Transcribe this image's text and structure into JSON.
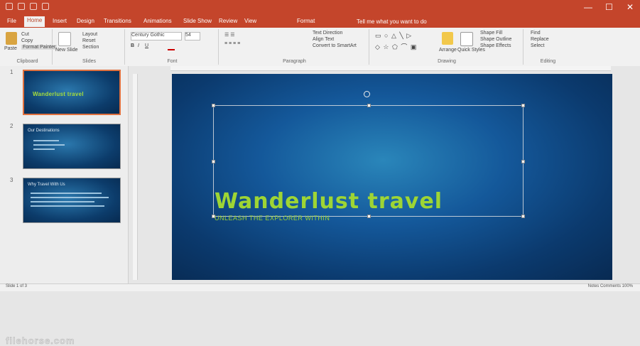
{
  "app": {
    "window_title": "",
    "title_color": "#c4452b",
    "accent_color": "#b7472a"
  },
  "quick_access": {
    "icons": [
      "save-icon",
      "undo-icon",
      "redo-icon",
      "start-slideshow-icon"
    ]
  },
  "window_controls": {
    "minimize": "—",
    "restore": "☐",
    "close": "✕"
  },
  "tabs": [
    {
      "label": "File"
    },
    {
      "label": "Home",
      "active": true
    },
    {
      "label": "Insert"
    },
    {
      "label": "Design"
    },
    {
      "label": "Transitions"
    },
    {
      "label": "Animations"
    },
    {
      "label": "Slide Show"
    },
    {
      "label": "Review"
    },
    {
      "label": "View"
    },
    {
      "label": "Format"
    }
  ],
  "tell_me": "Tell me what you want to do",
  "ribbon": {
    "clipboard": {
      "paste": "Paste",
      "cut": "Cut",
      "copy": "Copy",
      "format_painter": "Format Painter",
      "title": "Clipboard"
    },
    "slides": {
      "new_slide": "New Slide",
      "layout": "Layout",
      "reset": "Reset",
      "section": "Section",
      "title": "Slides"
    },
    "font": {
      "font_name": "Century Gothic",
      "font_size": "54",
      "title": "Font"
    },
    "paragraph": {
      "text_direction": "Text Direction",
      "align_text": "Align Text",
      "convert_smartart": "Convert to SmartArt",
      "title": "Paragraph"
    },
    "drawing": {
      "arrange": "Arrange",
      "quick_styles": "Quick Styles",
      "shape_fill": "Shape Fill",
      "shape_outline": "Shape Outline",
      "shape_effects": "Shape Effects",
      "title": "Drawing"
    },
    "editing": {
      "find": "Find",
      "replace": "Replace",
      "select": "Select",
      "title": "Editing"
    }
  },
  "slides_panel": {
    "slides": [
      {
        "number": "1",
        "title": "Wanderlust travel"
      },
      {
        "number": "2",
        "title": "Our Destinations"
      },
      {
        "number": "3",
        "title": "Why Travel With Us"
      }
    ]
  },
  "main_slide": {
    "title": "Wanderlust travel",
    "subtitle": "UNLEASH THE EXPLORER WITHIN"
  },
  "statusbar": {
    "left": "Slide 1 of 3",
    "right": "Notes   Comments   100%"
  },
  "watermark": "filehorse.com"
}
